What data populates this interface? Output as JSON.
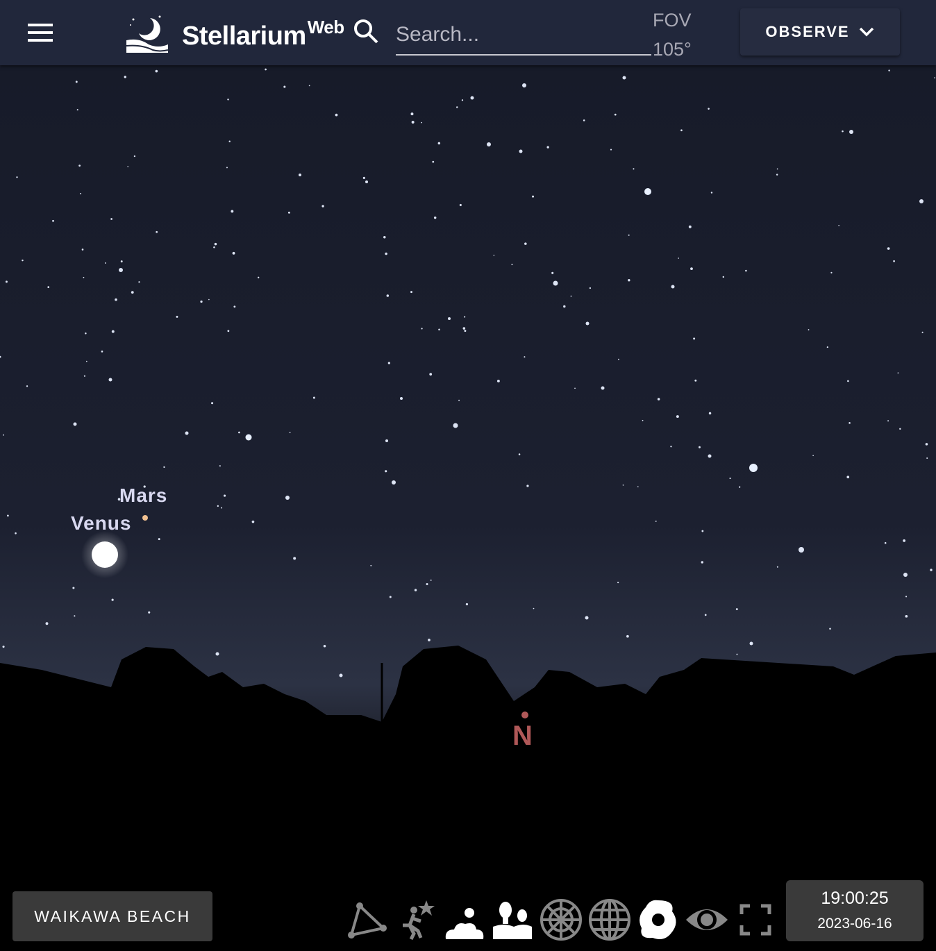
{
  "app": {
    "brand": "Stellarium",
    "brand_sup": "Web"
  },
  "search": {
    "placeholder": "Search..."
  },
  "fov": {
    "label": "FOV",
    "value": "105°"
  },
  "observe": {
    "label": "OBSERVE"
  },
  "sky": {
    "labels": {
      "mars": "Mars",
      "venus": "Venus",
      "north": "N"
    }
  },
  "location": {
    "label": "WAIKAWA BEACH"
  },
  "toolbar": {
    "icons": [
      "constellation-lines-icon",
      "constellation-art-icon",
      "atmosphere-icon",
      "landscape-icon",
      "azimuthal-grid-icon",
      "equatorial-grid-icon",
      "deep-sky-objects-icon",
      "night-mode-icon",
      "fullscreen-icon"
    ]
  },
  "datetime": {
    "time": "19:00:25",
    "date": "2023-06-16"
  },
  "colors": {
    "topbar": "#22283c",
    "sky_top": "#161a28",
    "sky_horizon": "#2c3244",
    "north": "#b05858",
    "button": "#3a3a3a"
  }
}
